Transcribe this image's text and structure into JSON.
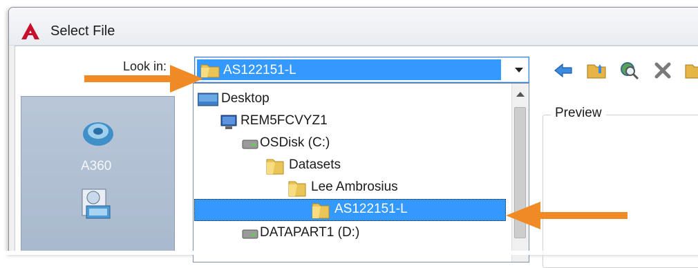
{
  "window": {
    "title": "Select File"
  },
  "look_in": {
    "label": "Look in:",
    "value": "AS122151-L"
  },
  "toolbar": {
    "icons": [
      "back-icon",
      "up-one-level-icon",
      "search-web-icon",
      "delete-icon",
      "create-folder-icon"
    ]
  },
  "places": {
    "items": [
      {
        "label": "A360",
        "icon": "a360-icon"
      },
      {
        "label": "",
        "icon": "history-icon"
      }
    ]
  },
  "dropdown": {
    "items": [
      {
        "label": "Desktop",
        "icon": "desktop-icon"
      },
      {
        "label": "REM5FCVYZ1",
        "icon": "computer-icon"
      },
      {
        "label": "OSDisk (C:)",
        "icon": "drive-icon"
      },
      {
        "label": "Datasets",
        "icon": "folder-icon"
      },
      {
        "label": "Lee Ambrosius",
        "icon": "folder-icon"
      },
      {
        "label": "AS122151-L",
        "icon": "folder-open-icon",
        "selected": true
      },
      {
        "label": "DATAPART1 (D:)",
        "icon": "drive-icon"
      }
    ]
  },
  "preview": {
    "label": "Preview"
  },
  "colors": {
    "selection": "#3399ff",
    "callout_arrow": "#f08a24",
    "autocad_red": "#c8102e"
  }
}
